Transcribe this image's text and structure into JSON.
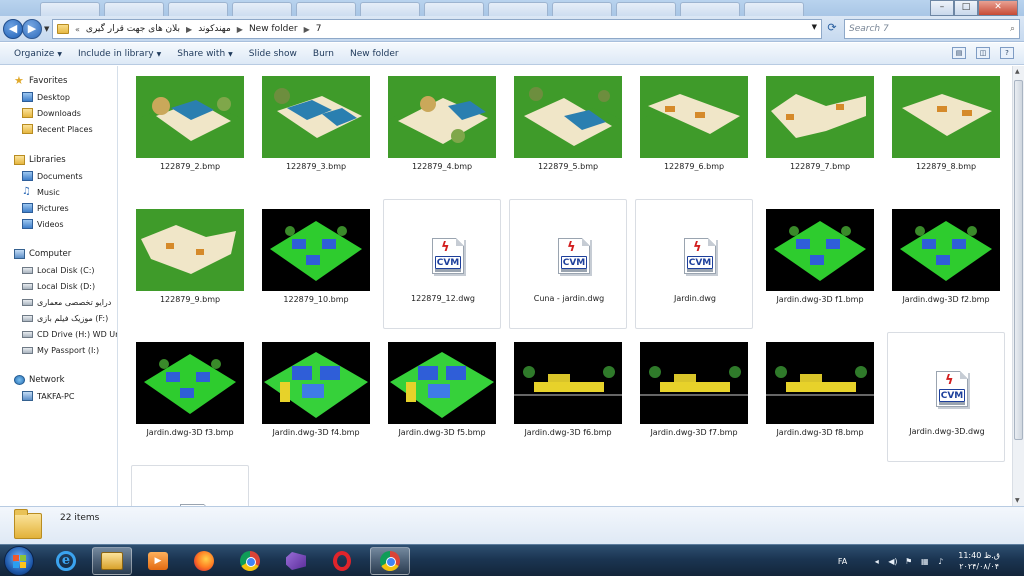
{
  "window": {
    "min_label": "–",
    "max_label": "□",
    "close_label": "✕"
  },
  "address": {
    "segments": [
      "بلان های جهت قرار گیری",
      "مهندکوند",
      "New folder",
      "7"
    ],
    "search_placeholder": "Search 7"
  },
  "toolbar": {
    "organize": "Organize",
    "include": "Include in library",
    "share": "Share with",
    "slideshow": "Slide show",
    "burn": "Burn",
    "newfolder": "New folder"
  },
  "nav": {
    "favorites": "Favorites",
    "desktop": "Desktop",
    "downloads": "Downloads",
    "recent": "Recent Places",
    "libraries": "Libraries",
    "documents": "Documents",
    "music": "Music",
    "pictures": "Pictures",
    "videos": "Videos",
    "computer": "Computer",
    "disk_c": "Local Disk (C:)",
    "disk_d": "Local Disk (D:)",
    "disk_e": "درایو تخصصی معماری",
    "disk_f": "موزیک فیلم بازی (F:)",
    "disk_h": "CD Drive (H:) WD Ur",
    "disk_i": "My Passport (I:)",
    "network": "Network",
    "takfa": "TAKFA-PC"
  },
  "files": [
    {
      "name": "122879_2.bmp",
      "kind": "green"
    },
    {
      "name": "122879_3.bmp",
      "kind": "green"
    },
    {
      "name": "122879_4.bmp",
      "kind": "green"
    },
    {
      "name": "122879_5.bmp",
      "kind": "green"
    },
    {
      "name": "122879_6.bmp",
      "kind": "green"
    },
    {
      "name": "122879_7.bmp",
      "kind": "green"
    },
    {
      "name": "122879_8.bmp",
      "kind": "green"
    },
    {
      "name": "122879_9.bmp",
      "kind": "green"
    },
    {
      "name": "122879_10.bmp",
      "kind": "black"
    },
    {
      "name": "122879_12.dwg",
      "kind": "dwg"
    },
    {
      "name": "Cuna - jardin.dwg",
      "kind": "dwg"
    },
    {
      "name": "Jardin.dwg",
      "kind": "dwg"
    },
    {
      "name": "Jardin.dwg-3D f1.bmp",
      "kind": "black"
    },
    {
      "name": "Jardin.dwg-3D f2.bmp",
      "kind": "black"
    },
    {
      "name": "Jardin.dwg-3D f3.bmp",
      "kind": "black"
    },
    {
      "name": "Jardin.dwg-3D f4.bmp",
      "kind": "black"
    },
    {
      "name": "Jardin.dwg-3D f5.bmp",
      "kind": "black"
    },
    {
      "name": "Jardin.dwg-3D f6.bmp",
      "kind": "black"
    },
    {
      "name": "Jardin.dwg-3D f7.bmp",
      "kind": "black"
    },
    {
      "name": "Jardin.dwg-3D f8.bmp",
      "kind": "black"
    },
    {
      "name": "Jardin.dwg-3D.dwg",
      "kind": "dwg"
    },
    {
      "name": "",
      "kind": "dwg"
    }
  ],
  "dwg_icon": {
    "glyph": "ϟ",
    "text": "CVM"
  },
  "details": {
    "count": "22 items"
  },
  "tray": {
    "lang": "FA",
    "time": "11:40 ق.ظ",
    "date": "۲۰۲۴/۰۸/۰۴"
  },
  "colors": {
    "grass": "#3f9b2a",
    "roof": "#2a7fb0",
    "wall": "#f0e6c8",
    "selection": "#99c6f2"
  }
}
